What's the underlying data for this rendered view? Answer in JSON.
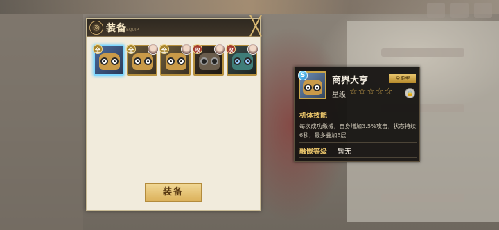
{
  "panel": {
    "title": "装备",
    "subtitle": "EQUIP",
    "emblem": "◎",
    "close_icon": "╳",
    "equip_button": "装备",
    "slots": [
      {
        "badge": "全",
        "badge_color": "#a8852c",
        "style": "selected",
        "has_portrait": false
      },
      {
        "badge": "全",
        "badge_color": "#a8852c",
        "style": "normal",
        "has_portrait": true
      },
      {
        "badge": "全",
        "badge_color": "#a8852c",
        "style": "normal",
        "has_portrait": true
      },
      {
        "badge": "攻",
        "badge_color": "#a33a2c",
        "style": "dark",
        "has_portrait": true
      },
      {
        "badge": "攻",
        "badge_color": "#a33a2c",
        "style": "teal",
        "has_portrait": true
      }
    ]
  },
  "card": {
    "rank": "S",
    "name": "商界大亨",
    "tag": "全能型",
    "stars_label": "星级",
    "stars": [
      "☆",
      "☆",
      "☆",
      "☆",
      "☆"
    ],
    "lock_icon": "🔒",
    "skill_label": "机体技能",
    "skill_desc": "每次成功缴械，自身增加3.5%攻击，状态持续6秒，最多叠加5层",
    "fusion_label": "融嵌等级",
    "fusion_value": "暂无"
  },
  "colors": {
    "accent_gold": "#e9c46a",
    "panel_bg": "#f1ebdc",
    "card_bg": "#161412"
  }
}
